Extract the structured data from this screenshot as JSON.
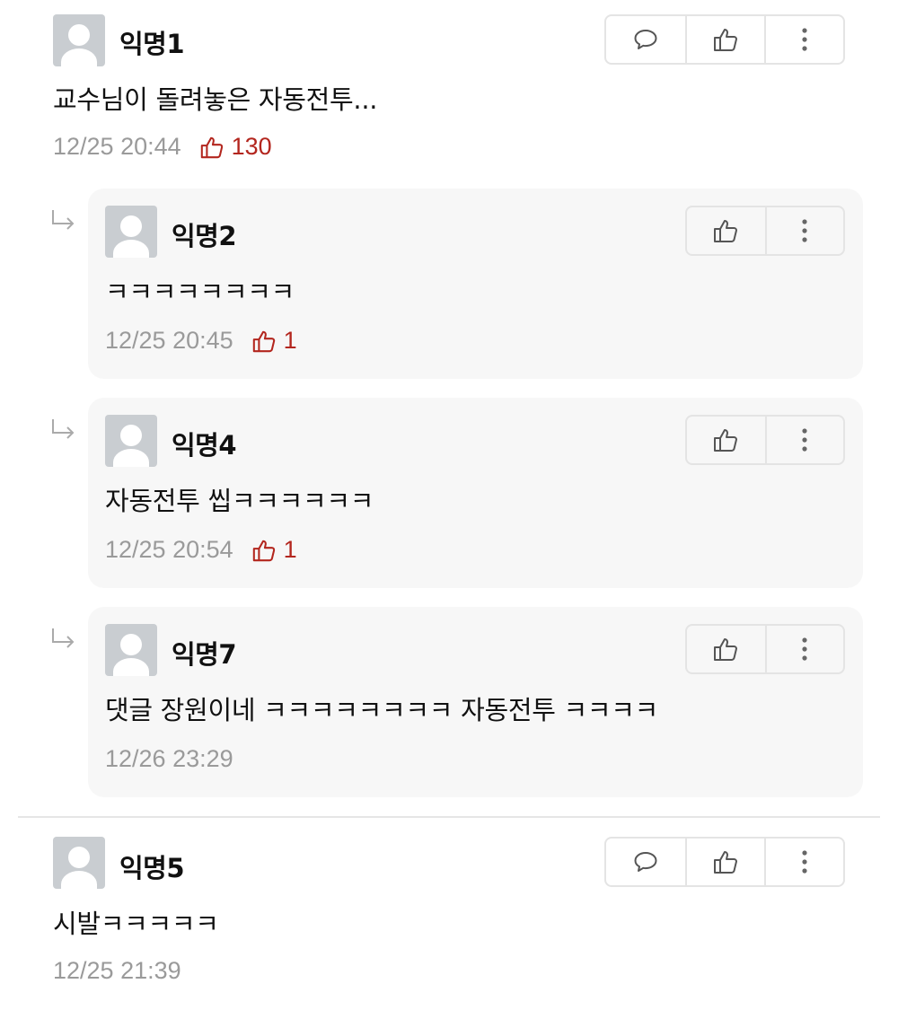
{
  "comments": [
    {
      "author": "익명1",
      "text": "교수님이 돌려놓은 자동전투...",
      "time": "12/25 20:44",
      "likes": "130",
      "actions": [
        "comment-icon",
        "thumbs-up-icon",
        "more-vertical-icon"
      ]
    },
    {
      "author": "익명5",
      "text": "시발ㅋㅋㅋㅋㅋ",
      "time": "12/25 21:39",
      "actions": [
        "comment-icon",
        "thumbs-up-icon",
        "more-vertical-icon"
      ]
    }
  ],
  "replies": [
    {
      "author": "익명2",
      "text": "ㅋㅋㅋㅋㅋㅋㅋㅋ",
      "time": "12/25 20:45",
      "likes": "1",
      "actions": [
        "thumbs-up-icon",
        "more-vertical-icon"
      ]
    },
    {
      "author": "익명4",
      "text": "자동전투 씹ㅋㅋㅋㅋㅋㅋ",
      "time": "12/25 20:54",
      "likes": "1",
      "actions": [
        "thumbs-up-icon",
        "more-vertical-icon"
      ]
    },
    {
      "author": "익명7",
      "text": "댓글 장원이네 ㅋㅋㅋㅋㅋㅋㅋㅋ 자동전투 ㅋㅋㅋㅋ",
      "time": "12/26 23:29",
      "actions": [
        "thumbs-up-icon",
        "more-vertical-icon"
      ]
    }
  ],
  "colors": {
    "like_red": "#b3261e",
    "meta_gray": "#9a9a9a",
    "reply_bg": "#f7f7f7",
    "avatar_gray": "#c9cdd1"
  }
}
